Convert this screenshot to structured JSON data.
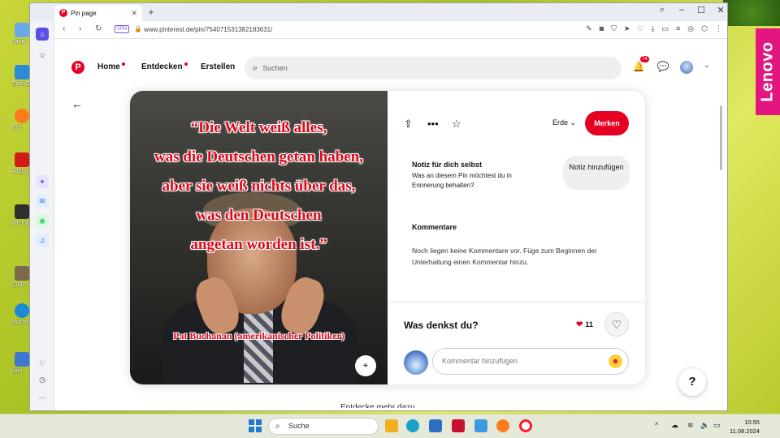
{
  "browser": {
    "tab_title": "Pin page",
    "url": "www.pinterest.de/pin/754071531382183631/",
    "vpn_label": "VPN",
    "accent": "#ff1b2d"
  },
  "desktop": {
    "icons": [
      "Papie",
      "OpenOff",
      "Fire",
      "Adobe",
      "We Informat",
      "GIMP",
      "Micros",
      "pain"
    ],
    "brand": "Lenovo"
  },
  "header": {
    "nav": [
      {
        "label": "Home",
        "dot": true
      },
      {
        "label": "Entdecken",
        "dot": true
      },
      {
        "label": "Erstellen",
        "dot": false
      }
    ],
    "search_placeholder": "Suchen",
    "notification_count": "74",
    "brand_color": "#e60023"
  },
  "pin": {
    "quote_lines": [
      "“Die Welt weiß alles,",
      "was die Deutschen getan haben,",
      "aber sie weiß nichts über das,",
      "was den Deutschen",
      "angetan worden ist.”"
    ],
    "author": "Pat Buchanan (amerikanischer Politiker)"
  },
  "detail": {
    "board": "Erde",
    "save_label": "Merken",
    "note_title": "Notiz für dich selbst",
    "note_desc": "Was an diesem Pin möchtest du in Erinnerung behalten?",
    "note_button": "Notiz hinzufügen",
    "comments_title": "Kommentare",
    "comments_empty": "Noch liegen keine Kommentare vor. Füge zum Beginnen der Unterhaltung einen Kommentar hinzu.",
    "what_think": "Was denkst du?",
    "reaction_count": "11",
    "comment_placeholder": "Kommentar hinzufügen"
  },
  "help_label": "?",
  "more_ideas": "Entdecke mehr dazu",
  "taskbar": {
    "search_label": "Suche",
    "time": "10:55",
    "date": "11.08.2024"
  }
}
